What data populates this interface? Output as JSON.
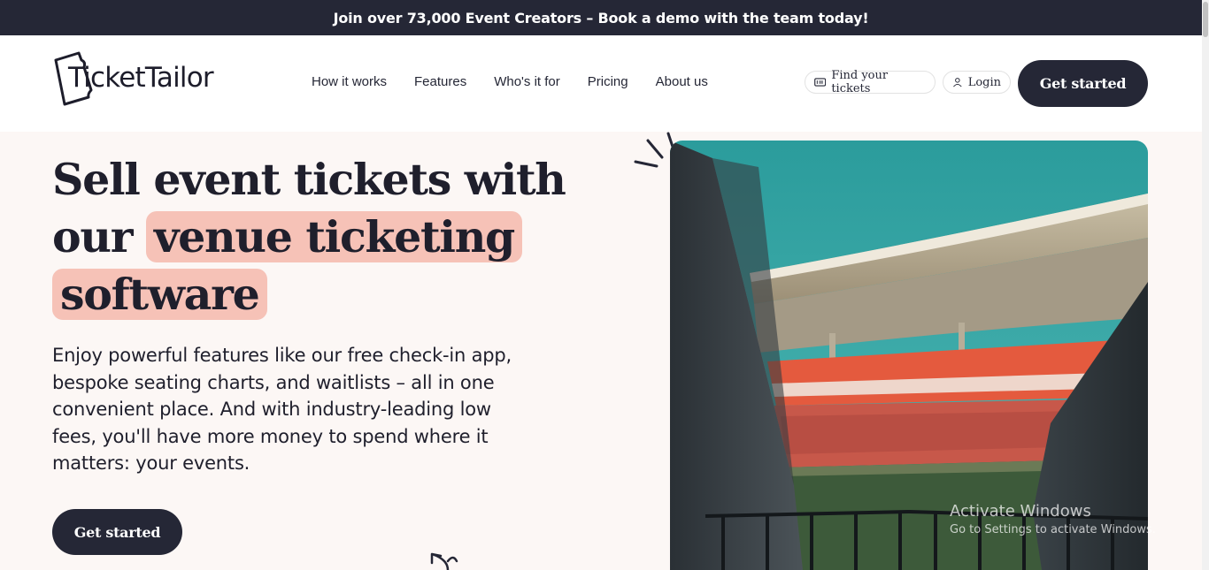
{
  "announcement": {
    "text": "Join over 73,000 Event Creators – Book a demo with the team today!"
  },
  "header": {
    "logo_text": "TicketTailor",
    "nav": [
      "How it works",
      "Features",
      "Who's it for",
      "Pricing",
      "About us"
    ],
    "find_tickets_label": "Find your tickets",
    "login_label": "Login",
    "get_started_label": "Get started"
  },
  "hero": {
    "title_line1": "Sell event tickets with",
    "title_our": "our",
    "title_highlight1": "venue ticketing",
    "title_highlight2": "software",
    "body": "Enjoy powerful features like our free check-in app, bespoke seating charts, and waitlists – all in one convenient place. And with industry-leading low fees, you'll have more money to spend where it matters: your events.",
    "cta_label": "Get started"
  },
  "icons": {
    "logo": "ticket-logo-icon",
    "find_tickets": "ticket-icon",
    "login": "user-icon",
    "doodle_lines": "sparkle-lines-icon",
    "doodle_arrow": "arrow-icon"
  },
  "colors": {
    "dark": "#252736",
    "highlight": "#f6c2b7",
    "hero_bg": "#fcf7f5"
  },
  "os_overlay": {
    "title": "Activate Windows",
    "subtitle": "Go to Settings to activate Windows."
  }
}
